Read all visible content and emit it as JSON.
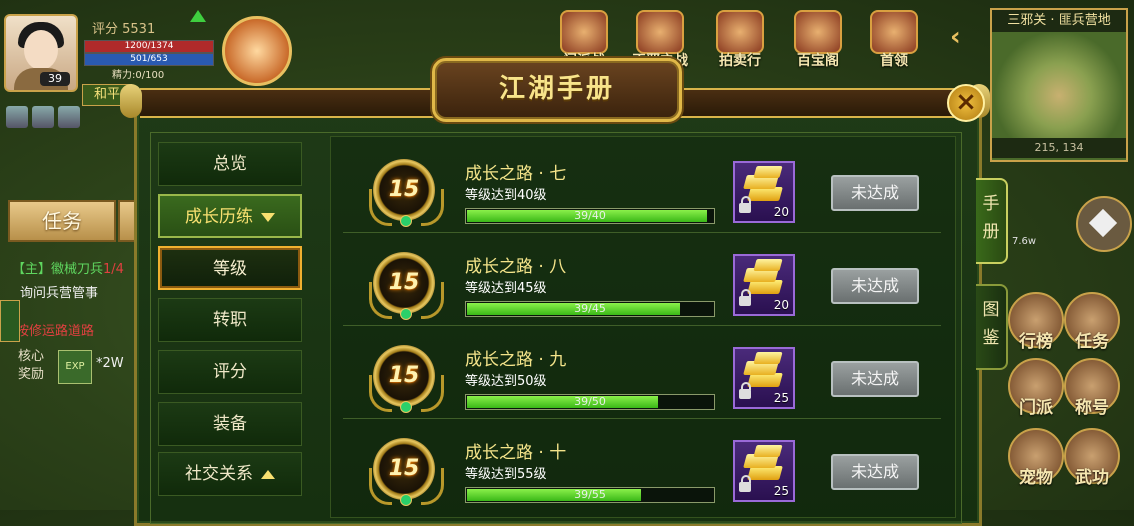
{
  "hud": {
    "score": "评分 5531",
    "level": "39",
    "hp": "1200/1374",
    "mp": "501/653",
    "energy": "精力:0/100",
    "peace_mode": "和平",
    "task_button": "任务",
    "quest_line1_prefix": "【主】",
    "quest_line1_text": "徽械刀兵",
    "quest_line1_suffix": "1/4",
    "quest_line2": "询问兵营管事",
    "quest_line3": "按修运路道路",
    "reward_label": "核心\n奖励",
    "exp_icon": "EXP",
    "exp_amount": "*2W",
    "power": "7.6w"
  },
  "top_menu": [
    {
      "label": "门派战",
      "icon": "door-icon"
    },
    {
      "label": "正邪之战",
      "icon": "war-icon"
    },
    {
      "label": "拍卖行",
      "icon": "abacus-icon"
    },
    {
      "label": "百宝阁",
      "icon": "pavilion-icon"
    },
    {
      "label": "首领",
      "icon": "boss-icon"
    }
  ],
  "minimap": {
    "location": "三邪关 · 匪兵营地",
    "coords": "215, 134"
  },
  "right_buttons": [
    {
      "label": "行榜"
    },
    {
      "label": "任务"
    },
    {
      "label": "门派"
    },
    {
      "label": "称号"
    },
    {
      "label": "宠物"
    },
    {
      "label": "武功"
    }
  ],
  "panel": {
    "title": "江湖手册",
    "close": "×",
    "side_tabs": [
      {
        "label": "手\n册",
        "active": true
      },
      {
        "label": "图\n鉴",
        "active": false
      }
    ],
    "nav": [
      {
        "label": "总览",
        "type": "item"
      },
      {
        "label": "成长历练",
        "type": "category",
        "expanded": true
      },
      {
        "label": "等级",
        "type": "item",
        "selected": true
      },
      {
        "label": "转职",
        "type": "item"
      },
      {
        "label": "评分",
        "type": "item"
      },
      {
        "label": "装备",
        "type": "item"
      },
      {
        "label": "社交关系",
        "type": "category",
        "expanded": false
      }
    ],
    "rows": [
      {
        "medal": "15",
        "title": "成长之路 · 七",
        "desc": "等级达到40级",
        "progress_text": "39/40",
        "progress": 0.975,
        "reward_qty": "20",
        "status": "未达成"
      },
      {
        "medal": "15",
        "title": "成长之路 · 八",
        "desc": "等级达到45级",
        "progress_text": "39/45",
        "progress": 0.867,
        "reward_qty": "20",
        "status": "未达成"
      },
      {
        "medal": "15",
        "title": "成长之路 · 九",
        "desc": "等级达到50级",
        "progress_text": "39/50",
        "progress": 0.78,
        "reward_qty": "25",
        "status": "未达成"
      },
      {
        "medal": "15",
        "title": "成长之路 · 十",
        "desc": "等级达到55级",
        "progress_text": "39/55",
        "progress": 0.709,
        "reward_qty": "25",
        "status": "未达成"
      }
    ]
  }
}
